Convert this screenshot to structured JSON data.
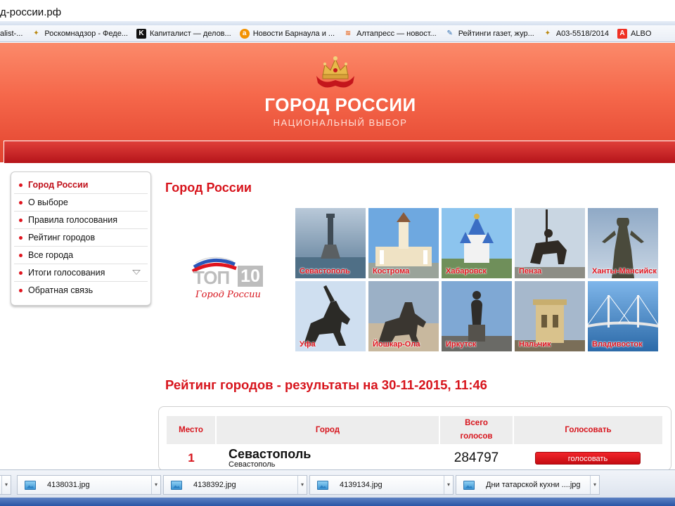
{
  "browser": {
    "url": "д-россии.рф"
  },
  "bookmarks": [
    {
      "label": "alist-...",
      "icon": "globe-icon"
    },
    {
      "label": "Роскомнадзор - Феде...",
      "icon": "emblem-icon"
    },
    {
      "label": "Капиталист — делов...",
      "icon": "k-logo-icon"
    },
    {
      "label": "Новости Барнаула и ...",
      "icon": "orange-a-icon"
    },
    {
      "label": "Алтапресс — новост...",
      "icon": "wave-icon"
    },
    {
      "label": "Рейтинги газет, жур...",
      "icon": "newspaper-icon"
    },
    {
      "label": "А03-5518/2014",
      "icon": "emblem-icon"
    },
    {
      "label": "ALBO",
      "icon": "alfa-icon"
    }
  ],
  "site": {
    "title": "ГОРОД РОССИИ",
    "subtitle": "НАЦИОНАЛЬНЫЙ ВЫБОР"
  },
  "sidebar": {
    "items": [
      {
        "label": "Город России",
        "active": true
      },
      {
        "label": "О выборе"
      },
      {
        "label": "Правила голосования"
      },
      {
        "label": "Рейтинг городов"
      },
      {
        "label": "Все города"
      },
      {
        "label": "Итоги голосования",
        "dropdown": true
      },
      {
        "label": "Обратная связь"
      }
    ]
  },
  "main": {
    "heading": "Город России",
    "logo": {
      "top": "ТОП",
      "num": "10",
      "script": "Город России"
    },
    "cities": [
      {
        "label": "Севастополь"
      },
      {
        "label": "Кострома"
      },
      {
        "label": "Хабаровск"
      },
      {
        "label": "Пенза"
      },
      {
        "label": "Ханты-Мансийск"
      },
      {
        "label": "Уфа"
      },
      {
        "label": "Йошкар-Ола"
      },
      {
        "label": "Иркутск"
      },
      {
        "label": "Нальчик"
      },
      {
        "label": "Владивосток"
      }
    ],
    "rating_title": "Рейтинг городов - результаты на 30-11-2015, 11:46",
    "table": {
      "headers": {
        "place": "Место",
        "city": "Город",
        "votes": "Всего голосов",
        "vote": "Голосовать"
      },
      "rows": [
        {
          "place": "1",
          "city": "Севастополь",
          "region": "Севастополь",
          "votes": "284797",
          "button": "голосовать"
        }
      ]
    }
  },
  "downloads": [
    {
      "name": "4138031.jpg"
    },
    {
      "name": "4138392.jpg"
    },
    {
      "name": "4139134.jpg"
    },
    {
      "name": "Дни татарской кухни ....jpg"
    }
  ],
  "colors": {
    "accent_red": "#d7141c",
    "header_top": "#fb8a6a",
    "header_bottom": "#e2432f"
  }
}
